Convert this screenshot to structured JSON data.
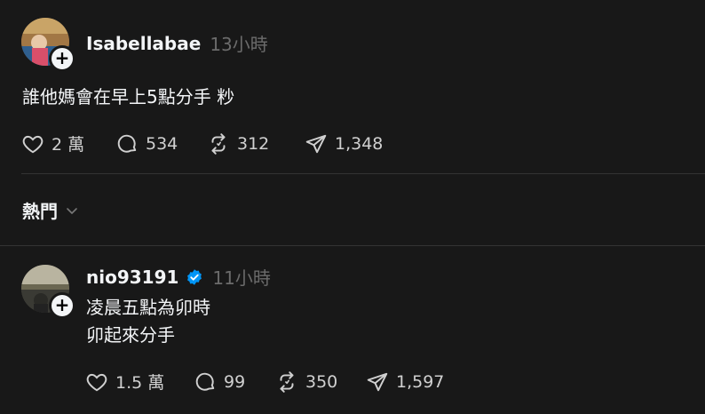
{
  "post1": {
    "username": "Isabellabae",
    "time": "13小時",
    "text": "誰他媽會在早上5點分手 粆",
    "likes": "2 萬",
    "replies": "534",
    "reposts": "312",
    "shares": "1,348"
  },
  "filter": {
    "label": "熱門"
  },
  "post2": {
    "username": "nio93191",
    "time": "11小時",
    "text_line1": "凌晨五點為卯時",
    "text_line2": "卯起來分手",
    "likes": "1.5 萬",
    "replies": "99",
    "reposts": "350",
    "shares": "1,597"
  },
  "colors": {
    "background": "#181818",
    "text": "#f3f5f7",
    "muted": "#6b6b6b",
    "verified": "#0095f6",
    "divider": "#333333"
  },
  "icons": {
    "like": "heart-icon",
    "reply": "comment-icon",
    "repost": "repost-icon",
    "share": "send-icon",
    "follow": "plus-icon",
    "verified": "verified-badge-icon",
    "dropdown": "chevron-down-icon"
  }
}
